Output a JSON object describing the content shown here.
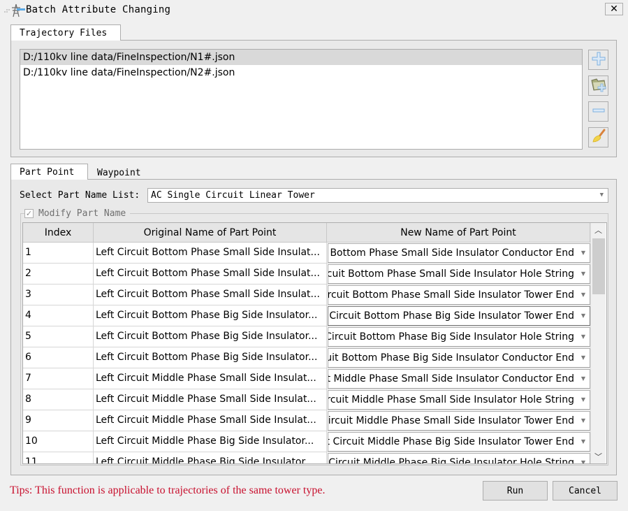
{
  "window": {
    "title": "Batch Attribute Changing",
    "app_icon": "tower-icon",
    "close_label": "✕"
  },
  "trajectory": {
    "tab_label": "Trajectory Files",
    "files": [
      "D:/110kv line data/FineInspection/N1#.json",
      "D:/110kv line data/FineInspection/N2#.json"
    ],
    "selected_index": 0,
    "side_buttons": [
      {
        "name": "add-file",
        "icon": "plus-icon"
      },
      {
        "name": "add-folder",
        "icon": "folder-add-icon"
      },
      {
        "name": "remove-file",
        "icon": "minus-icon"
      },
      {
        "name": "clear-list",
        "icon": "broom-icon"
      }
    ]
  },
  "tabs": [
    {
      "label": "Part Point",
      "active": true
    },
    {
      "label": "Waypoint",
      "active": false
    }
  ],
  "part_point": {
    "select_label": "Select Part Name List:",
    "select_value": "AC Single Circuit Linear Tower",
    "modify_checkbox_label": "Modify Part Name",
    "modify_checked": true,
    "table": {
      "headers": [
        "Index",
        "Original Name of Part Point",
        "New Name of Part Point"
      ],
      "rows": [
        {
          "index": "1",
          "original": "Left Circuit Bottom Phase Small Side Insulat...",
          "new": "Left Circuit Bottom Phase Small Side Insulator Conductor End"
        },
        {
          "index": "2",
          "original": "Left Circuit Bottom Phase Small Side Insulat...",
          "new": "Left Circuit Bottom Phase Small Side Insulator Hole String"
        },
        {
          "index": "3",
          "original": "Left Circuit Bottom Phase Small Side Insulat...",
          "new": "Left Circuit Bottom Phase Small Side Insulator Tower End"
        },
        {
          "index": "4",
          "original": "Left Circuit Bottom Phase Big Side Insulator...",
          "new": "Left Circuit Bottom Phase Big Side Insulator Tower End"
        },
        {
          "index": "5",
          "original": "Left Circuit Bottom Phase Big Side Insulator...",
          "new": "Left Circuit Bottom Phase Big Side Insulator Hole String"
        },
        {
          "index": "6",
          "original": "Left Circuit Bottom Phase Big Side Insulator...",
          "new": "Left Circuit Bottom Phase Big Side Insulator Conductor End"
        },
        {
          "index": "7",
          "original": "Left Circuit Middle Phase Small Side Insulat...",
          "new": "Left Circuit Middle Phase Small Side Insulator Conductor End"
        },
        {
          "index": "8",
          "original": "Left Circuit Middle Phase Small Side Insulat...",
          "new": "Left Circuit Middle Phase Small Side Insulator Hole String"
        },
        {
          "index": "9",
          "original": "Left Circuit Middle Phase Small Side Insulat...",
          "new": "Left Circuit Middle Phase Small Side Insulator Tower End"
        },
        {
          "index": "10",
          "original": "Left Circuit Middle Phase Big Side Insulator...",
          "new": "Left Circuit Middle Phase Big Side Insulator Tower End"
        },
        {
          "index": "11",
          "original": "Left Circuit Middle Phase Big Side Insulator...",
          "new": "Left Circuit Middle Phase Big Side Insulator Hole String"
        }
      ],
      "focused_row": 3
    }
  },
  "footer": {
    "tips": "Tips: This function is applicable to trajectories of the same tower type.",
    "tips_color": "#c8102e",
    "run_label": "Run",
    "cancel_label": "Cancel"
  }
}
